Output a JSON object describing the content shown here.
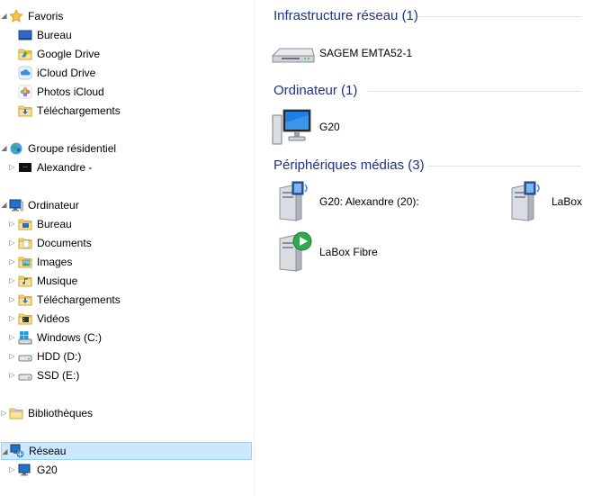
{
  "nav": {
    "favoris": {
      "label": "Favoris",
      "items": [
        {
          "label": "Bureau",
          "icon": "desktop-icon"
        },
        {
          "label": "Google Drive",
          "icon": "google-drive-icon"
        },
        {
          "label": "iCloud Drive",
          "icon": "icloud-drive-icon"
        },
        {
          "label": "Photos iCloud",
          "icon": "icloud-photos-icon"
        },
        {
          "label": "Téléchargements",
          "icon": "downloads-folder-icon"
        }
      ]
    },
    "groupe": {
      "label": "Groupe résidentiel",
      "items": [
        {
          "label": "Alexandre -",
          "icon": "user-avatar-icon"
        }
      ]
    },
    "ordinateur": {
      "label": "Ordinateur",
      "items": [
        {
          "label": "Bureau",
          "icon": "desktop-folder-icon"
        },
        {
          "label": "Documents",
          "icon": "documents-folder-icon"
        },
        {
          "label": "Images",
          "icon": "pictures-folder-icon"
        },
        {
          "label": "Musique",
          "icon": "music-folder-icon"
        },
        {
          "label": "Téléchargements",
          "icon": "downloads-folder-icon"
        },
        {
          "label": "Vidéos",
          "icon": "videos-folder-icon"
        },
        {
          "label": "Windows (C:)",
          "icon": "windows-drive-icon"
        },
        {
          "label": "HDD (D:)",
          "icon": "hard-drive-icon"
        },
        {
          "label": "SSD (E:)",
          "icon": "hard-drive-icon"
        }
      ]
    },
    "bibliotheques": {
      "label": "Bibliothèques"
    },
    "reseau": {
      "label": "Réseau",
      "items": [
        {
          "label": "G20",
          "icon": "computer-icon"
        }
      ]
    }
  },
  "content": {
    "groups": [
      {
        "title": "Infrastructure réseau (1)",
        "items": [
          {
            "label": "SAGEM EMTA52-1",
            "icon": "router-icon"
          }
        ]
      },
      {
        "title": "Ordinateur (1)",
        "items": [
          {
            "label": "G20",
            "icon": "computer-icon"
          }
        ]
      },
      {
        "title": "Périphériques médias (3)",
        "items": [
          {
            "label": "G20: Alexandre (20):",
            "icon": "media-server-icon"
          },
          {
            "label": "LaBox",
            "icon": "media-server-icon"
          },
          {
            "label": "LaBox Fibre",
            "icon": "media-player-icon"
          }
        ]
      }
    ]
  },
  "colors": {
    "group_header": "#1e3287",
    "selection_bg": "#cce8ff",
    "selection_border": "#99d1ff"
  }
}
